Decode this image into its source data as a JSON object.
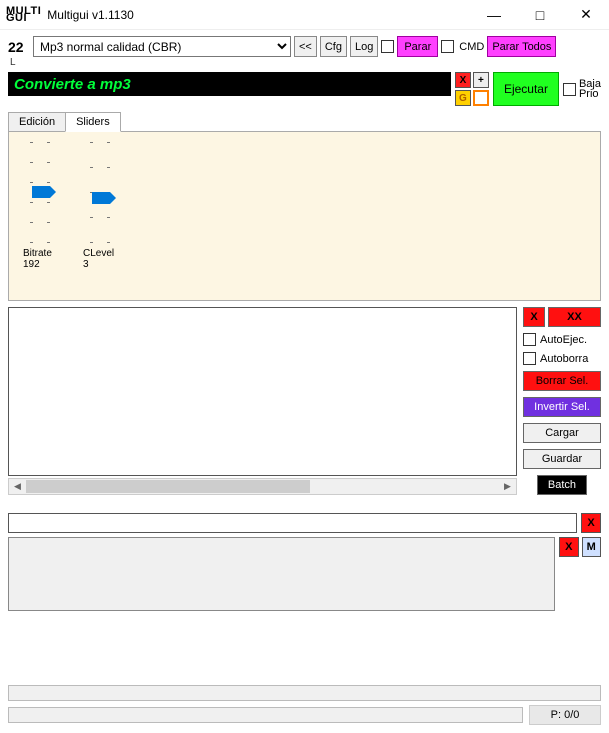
{
  "window": {
    "logo_line1": "MULTI",
    "logo_line2": "GUI",
    "title": "Multigui v1.1130",
    "minimize": "—",
    "maximize": "□",
    "close": "✕"
  },
  "top": {
    "count": "22",
    "count_sub": "L",
    "preset": "Mp3 normal calidad (CBR)",
    "back": "<<",
    "cfg": "Cfg",
    "log": "Log",
    "parar": "Parar",
    "cmd": "CMD",
    "parar_todos": "Parar Todos"
  },
  "banner": "Convierte a mp3",
  "mini": {
    "x": "X",
    "plus": "+",
    "g": "G"
  },
  "ejecutar": "Ejecutar",
  "baja": {
    "l1": "Baja",
    "l2": "Prio"
  },
  "tabs": {
    "edicion": "Edición",
    "sliders": "Sliders"
  },
  "sliders": {
    "bitrate_label": "Bitrate",
    "bitrate_value": "192",
    "clevel_label": "CLevel",
    "clevel_value": "3"
  },
  "side": {
    "x": "X",
    "xx": "XX",
    "autoejec": "AutoEjec.",
    "autoborra": "Autoborra",
    "borrar": "Borrar Sel.",
    "invertir": "Invertir Sel.",
    "cargar": "Cargar",
    "guardar": "Guardar",
    "batch": "Batch"
  },
  "bottom_x": "X",
  "bottom_m": "M",
  "pcount": "P: 0/0"
}
